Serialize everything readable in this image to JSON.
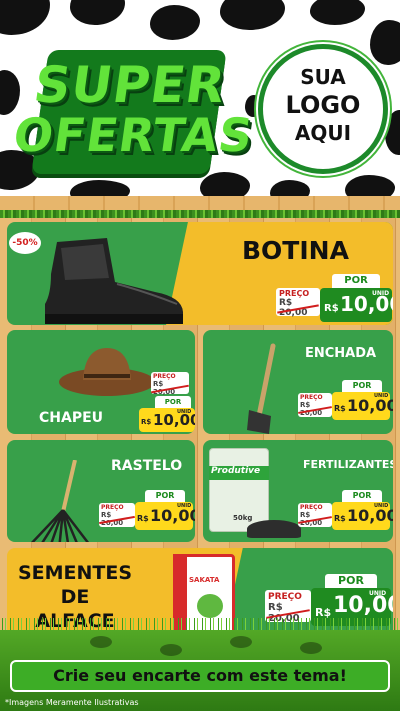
{
  "header": {
    "title_line1": "SUPER",
    "title_line2": "OFERTAS",
    "logo_line1": "SUA",
    "logo_line2": "LOGO",
    "logo_line3": "AQUI"
  },
  "discount_badge": "-50%",
  "products": [
    {
      "name": "BOTINA",
      "preco_label": "PREÇO",
      "old_price": "R$ 20,00",
      "por_label": "POR",
      "currency": "R$",
      "price": "10,00",
      "unit": "UNID"
    },
    {
      "name": "CHAPEU",
      "preco_label": "PREÇO",
      "old_price": "R$ 20,00",
      "por_label": "POR",
      "currency": "R$",
      "price": "10,00",
      "unit": "UNID"
    },
    {
      "name": "ENCHADA",
      "preco_label": "PREÇO",
      "old_price": "R$ 20,00",
      "por_label": "POR",
      "currency": "R$",
      "price": "10,00",
      "unit": "UNID"
    },
    {
      "name": "RASTELO",
      "preco_label": "PREÇO",
      "old_price": "R$ 20,00",
      "por_label": "POR",
      "currency": "R$",
      "price": "10,00",
      "unit": "UNID"
    },
    {
      "name": "FERTILIZANTES",
      "preco_label": "PREÇO",
      "old_price": "R$ 20,00",
      "por_label": "POR",
      "currency": "R$",
      "price": "10,00",
      "unit": "UNID"
    },
    {
      "name_line1": "SEMENTES",
      "name_line2": "DE",
      "name_line3": "ALFACE",
      "preco_label": "PREÇO",
      "old_price": "R$ 20,00",
      "por_label": "POR",
      "currency": "R$",
      "price": "10,00",
      "unit": "UNID"
    }
  ],
  "bag_brand": "Produtive",
  "bag_weight": "50kg",
  "seed_brand": "SAKATA",
  "footer": {
    "banner": "Crie seu encarte com este tema!",
    "disclaimer": "*Imagens Meramente Ilustrativas"
  },
  "colors": {
    "green": "#1f8b20",
    "yellow": "#f3bd2a",
    "card_green": "#38a04a",
    "red": "#d11d1d"
  }
}
